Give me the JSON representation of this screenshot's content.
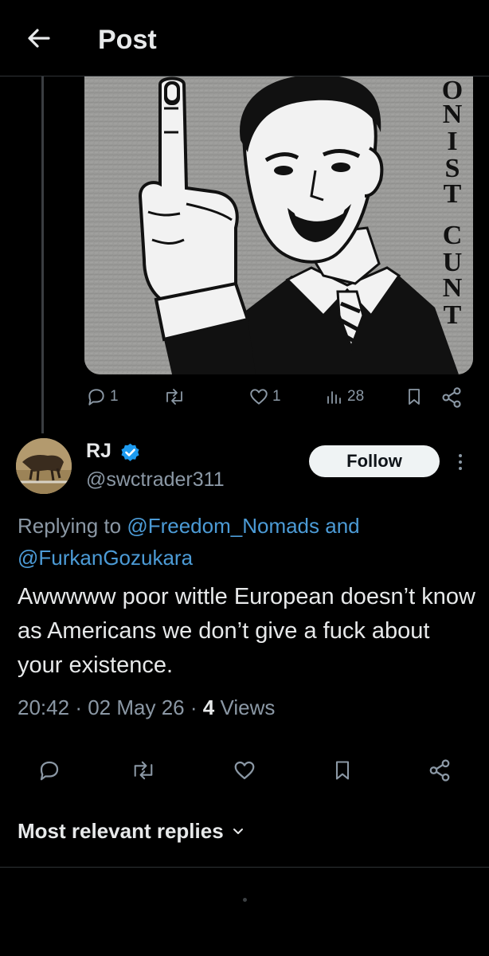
{
  "header": {
    "title": "Post"
  },
  "media": {
    "overlay_text": "ONIST CUNT"
  },
  "parent_actions": {
    "replies": "1",
    "reposts": "",
    "likes": "1",
    "views": "28"
  },
  "reply": {
    "name": "RJ",
    "handle": "@swctrader311",
    "follow_label": "Follow",
    "replying_prefix": "Replying to",
    "mention1": "@Freedom_Nomads",
    "and": "and",
    "mention2": "@FurkanGozukara",
    "text": "Awwwww poor wittle European doesn’t know as Americans we don’t give a fuck about your existence.",
    "time": "20:42",
    "date": "02 May 26",
    "views_count": "4",
    "views_label": "Views"
  },
  "sort": {
    "label": "Most relevant replies"
  },
  "colors": {
    "accent": "#1d9bf0",
    "link": "#4c9bd6",
    "muted": "#8b98a5",
    "background": "#000000"
  }
}
